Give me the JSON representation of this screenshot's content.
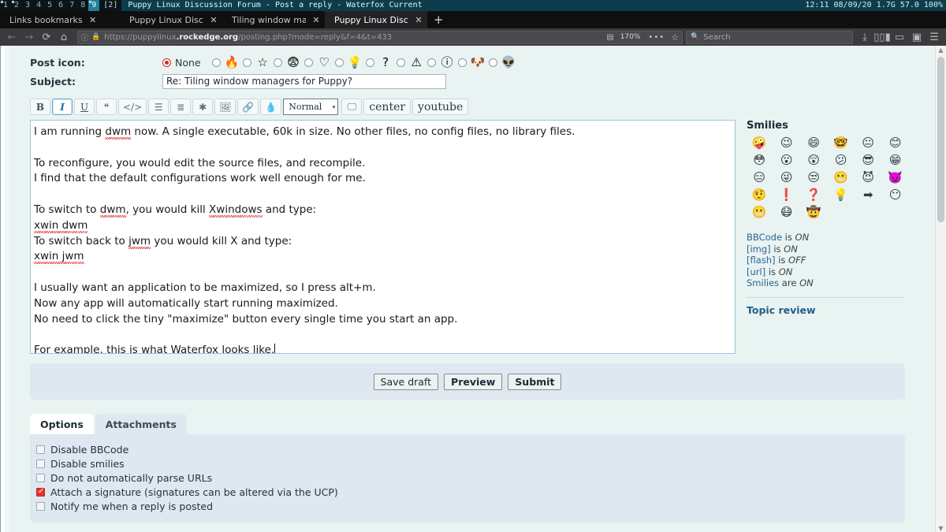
{
  "wm_bar": {
    "tags": [
      {
        "label": "1",
        "marked": true,
        "selected": false
      },
      {
        "label": "2",
        "marked": true,
        "selected": false
      },
      {
        "label": "3",
        "marked": false,
        "selected": false
      },
      {
        "label": "4",
        "marked": false,
        "selected": false
      },
      {
        "label": "5",
        "marked": false,
        "selected": false
      },
      {
        "label": "6",
        "marked": false,
        "selected": false
      },
      {
        "label": "7",
        "marked": false,
        "selected": false
      },
      {
        "label": "8",
        "marked": false,
        "selected": false
      },
      {
        "label": "9",
        "marked": true,
        "selected": true
      }
    ],
    "layout": "[2]",
    "window_title": "Puppy Linux Discussion Forum - Post a reply - Waterfox Current",
    "stats": "12:11 08/09/20 1.7G 57.0 100%"
  },
  "browser": {
    "tabs": [
      {
        "title": "Links bookmarks",
        "active": false
      },
      {
        "title": "Puppy Linux Discussion Foru",
        "active": false
      },
      {
        "title": "Tiling window managers for",
        "active": false
      },
      {
        "title": "Puppy Linux Discussion Foru",
        "active": true
      }
    ],
    "new_tab_label": "+",
    "nav": {
      "back": "←",
      "forward": "→",
      "reload": "⟳",
      "home": "⌂"
    },
    "url": {
      "scheme_prefix": "https://puppylinux",
      "host_emphasis": ".rockedge.org",
      "path": "/posting.php?mode=reply&f=4&t=433",
      "zoom_level": "170%",
      "identity_icon": "ⓘ",
      "lock_icon": "🔒",
      "reader_icon": "▤",
      "menu_dots": "•••",
      "bookmark_star": "☆"
    },
    "search": {
      "placeholder": "Search",
      "icon": "search-icon"
    },
    "toolbar_right": {
      "downloads": "⤓",
      "library": "▯▯▮",
      "sidebar": "▭",
      "account": "▣",
      "menu": "☰"
    }
  },
  "form": {
    "post_icon": {
      "label": "Post icon:",
      "options": [
        {
          "name": "none",
          "label": "None",
          "glyph": "",
          "selected": true
        },
        {
          "name": "fire",
          "label": "",
          "glyph": "🔥",
          "selected": false
        },
        {
          "name": "star",
          "label": "",
          "glyph": "☆",
          "selected": false
        },
        {
          "name": "surprise",
          "label": "",
          "glyph": "😨",
          "selected": false
        },
        {
          "name": "heart",
          "label": "",
          "glyph": "♡",
          "selected": false
        },
        {
          "name": "idea",
          "label": "",
          "glyph": "💡",
          "selected": false
        },
        {
          "name": "question",
          "label": "",
          "glyph": "?",
          "selected": false
        },
        {
          "name": "warning",
          "label": "",
          "glyph": "⚠",
          "selected": false
        },
        {
          "name": "info",
          "label": "",
          "glyph": "ⓘ",
          "selected": false
        },
        {
          "name": "puppy",
          "label": "",
          "glyph": "🐶",
          "selected": false
        },
        {
          "name": "alien",
          "label": "",
          "glyph": "👽",
          "selected": false
        }
      ]
    },
    "subject": {
      "label": "Subject:",
      "value": "Re: Tiling window managers for Puppy?",
      "placeholder": ""
    },
    "editor_toolbar": {
      "buttons": [
        {
          "name": "bold",
          "glyph": "B",
          "active": false,
          "style": "b"
        },
        {
          "name": "italic",
          "glyph": "I",
          "active": true,
          "style": "i"
        },
        {
          "name": "underline",
          "glyph": "U",
          "active": false,
          "style": "u"
        },
        {
          "name": "quote",
          "glyph": "❝",
          "active": false,
          "style": ""
        },
        {
          "name": "code",
          "glyph": "</>",
          "active": false,
          "style": ""
        },
        {
          "name": "list",
          "glyph": "☰",
          "active": false,
          "style": ""
        },
        {
          "name": "list-ordered",
          "glyph": "≣",
          "active": false,
          "style": ""
        },
        {
          "name": "list-item",
          "glyph": "✱",
          "active": false,
          "style": ""
        },
        {
          "name": "image",
          "glyph": "🖼",
          "active": false,
          "style": ""
        },
        {
          "name": "link",
          "glyph": "🔗",
          "active": false,
          "style": ""
        },
        {
          "name": "color",
          "glyph": "💧",
          "active": false,
          "style": ""
        }
      ],
      "font_size": {
        "value": "Normal",
        "caret": "▾"
      },
      "extra": [
        {
          "name": "screen",
          "glyph": "🖵",
          "word": false
        },
        {
          "name": "center",
          "glyph": "center",
          "word": true
        },
        {
          "name": "youtube",
          "glyph": "youtube",
          "word": true
        }
      ]
    },
    "message": {
      "lines": [
        {
          "segments": [
            {
              "t": "I am running "
            },
            {
              "t": "dwm",
              "spell": true
            },
            {
              "t": " now. A single executable, 60k in size. No other files, no config files, no library files."
            }
          ]
        },
        {
          "segments": []
        },
        {
          "segments": [
            {
              "t": "To reconfigure, you would edit the source files, and recompile."
            }
          ]
        },
        {
          "segments": [
            {
              "t": "I find that the default configurations work well enough for me."
            }
          ]
        },
        {
          "segments": []
        },
        {
          "segments": [
            {
              "t": "To switch to "
            },
            {
              "t": "dwm",
              "spell": true
            },
            {
              "t": ", you would kill "
            },
            {
              "t": "Xwindows",
              "spell": true
            },
            {
              "t": " and type:"
            }
          ]
        },
        {
          "segments": [
            {
              "t": "xwin dwm",
              "spell": true
            }
          ]
        },
        {
          "segments": [
            {
              "t": "To switch back to "
            },
            {
              "t": "jwm",
              "spell": true
            },
            {
              "t": " you would kill X and type:"
            }
          ]
        },
        {
          "segments": [
            {
              "t": "xwin jwm",
              "spell": true
            }
          ]
        },
        {
          "segments": []
        },
        {
          "segments": [
            {
              "t": "I usually want an application to be maximized, so I press alt+m."
            }
          ]
        },
        {
          "segments": [
            {
              "t": "Now any app will automatically start running maximized."
            }
          ]
        },
        {
          "segments": [
            {
              "t": "No need to click the tiny \"maximize\" button every single time you start an app."
            }
          ]
        },
        {
          "segments": []
        },
        {
          "segments": [
            {
              "t": "For example, this is what "
            },
            {
              "t": "Waterfox",
              "spell": true
            },
            {
              "t": " looks like."
            },
            {
              "caret": true
            }
          ]
        }
      ]
    },
    "buttons": [
      {
        "name": "save-draft",
        "label": "Save draft",
        "strong": false
      },
      {
        "name": "preview",
        "label": "Preview",
        "strong": true
      },
      {
        "name": "submit",
        "label": "Submit",
        "strong": true
      }
    ]
  },
  "sidebar": {
    "smilies_title": "Smilies",
    "smilies": [
      "🤪",
      "😉",
      "😄",
      "🤓",
      "😐",
      "😊",
      "😳",
      "😮",
      "😲",
      "😕",
      "😎",
      "😁",
      "😑",
      "😜",
      "😒",
      "😬",
      "😈",
      "👿",
      "🤨",
      "❗",
      "❓",
      "💡",
      "➡",
      "😶",
      "😬",
      "😷",
      "🤠"
    ],
    "rules": [
      {
        "key": "BBCode",
        "verb": " is ",
        "state": "ON"
      },
      {
        "key": "[img]",
        "verb": " is ",
        "state": "ON"
      },
      {
        "key": "[flash]",
        "verb": " is ",
        "state": "OFF"
      },
      {
        "key": "[url]",
        "verb": " is ",
        "state": "ON"
      },
      {
        "key": "Smilies",
        "verb": " are ",
        "state": "ON"
      }
    ],
    "topic_review": "Topic review"
  },
  "options_panel": {
    "tabs": [
      {
        "name": "options",
        "label": "Options",
        "selected": true
      },
      {
        "name": "attachments",
        "label": "Attachments",
        "selected": false
      }
    ],
    "checkboxes": [
      {
        "name": "disable-bbcode",
        "label": "Disable BBCode",
        "checked": false
      },
      {
        "name": "disable-smilies",
        "label": "Disable smilies",
        "checked": false
      },
      {
        "name": "no-parse-urls",
        "label": "Do not automatically parse URLs",
        "checked": false
      },
      {
        "name": "attach-signature",
        "label": "Attach a signature (signatures can be altered via the UCP)",
        "checked": true
      },
      {
        "name": "notify-reply",
        "label": "Notify me when a reply is posted",
        "checked": false
      }
    ]
  },
  "colors": {
    "wm_bar": "#0d3d4d",
    "wm_selected_tag": "#1f7f9c",
    "page_bg": "#e9f3f1",
    "panel_bg": "#dfe8f0",
    "link": "#1f5f8b",
    "checked": "#e8342c"
  }
}
